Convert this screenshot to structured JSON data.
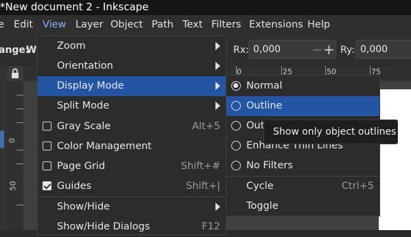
{
  "window": {
    "title": "*New document 2 - Inkscape"
  },
  "menubar": {
    "items": [
      "e",
      "Edit",
      "View",
      "Layer",
      "Object",
      "Path",
      "Text",
      "Filters",
      "Extensions",
      "Help"
    ],
    "active": "View"
  },
  "toolbar": {
    "change_label": "ange:",
    "w_label": "W:",
    "rx_label": "Rx:",
    "rx_value": "0,000",
    "ry_label": "Ry:",
    "ry_value": "0,000",
    "minus": "−",
    "plus": "+"
  },
  "ruler": {
    "top_labels": [
      "0",
      "25",
      "50",
      "75"
    ],
    "left_labels": [
      "0",
      "50"
    ]
  },
  "view_menu": {
    "items": [
      {
        "label": "Zoom"
      },
      {
        "label": "Orientation"
      },
      {
        "label": "Display Mode"
      },
      {
        "label": "Split Mode"
      },
      {
        "label": "Gray Scale",
        "shortcut": "Alt+5"
      },
      {
        "label": "Color Management"
      },
      {
        "label": "Page Grid",
        "shortcut": "Shift+#"
      },
      {
        "label": "Guides",
        "shortcut": "Shift+|"
      },
      {
        "label": "Show/Hide"
      },
      {
        "label": "Show/Hide Dialogs",
        "shortcut": "F12"
      }
    ]
  },
  "display_mode_menu": {
    "items": [
      {
        "label": "Normal"
      },
      {
        "label": "Outline"
      },
      {
        "label": "Outline Overlay"
      },
      {
        "label": "Enhance Thin Lines"
      },
      {
        "label": "No Filters"
      },
      {
        "label": "Cycle",
        "shortcut": "Ctrl+5"
      },
      {
        "label": "Toggle"
      }
    ],
    "selected": "Normal",
    "highlighted": "Outline"
  },
  "tooltip": {
    "text": "Show only object outlines"
  },
  "colors": {
    "highlight": "#2355a3",
    "menu_bg": "#2c2c2c",
    "active_menu_text": "#8ab4f8"
  },
  "icons": [
    "lock-icon",
    "submenu-arrow-icon",
    "checkbox-icon",
    "radio-icon",
    "checkmark-icon"
  ]
}
